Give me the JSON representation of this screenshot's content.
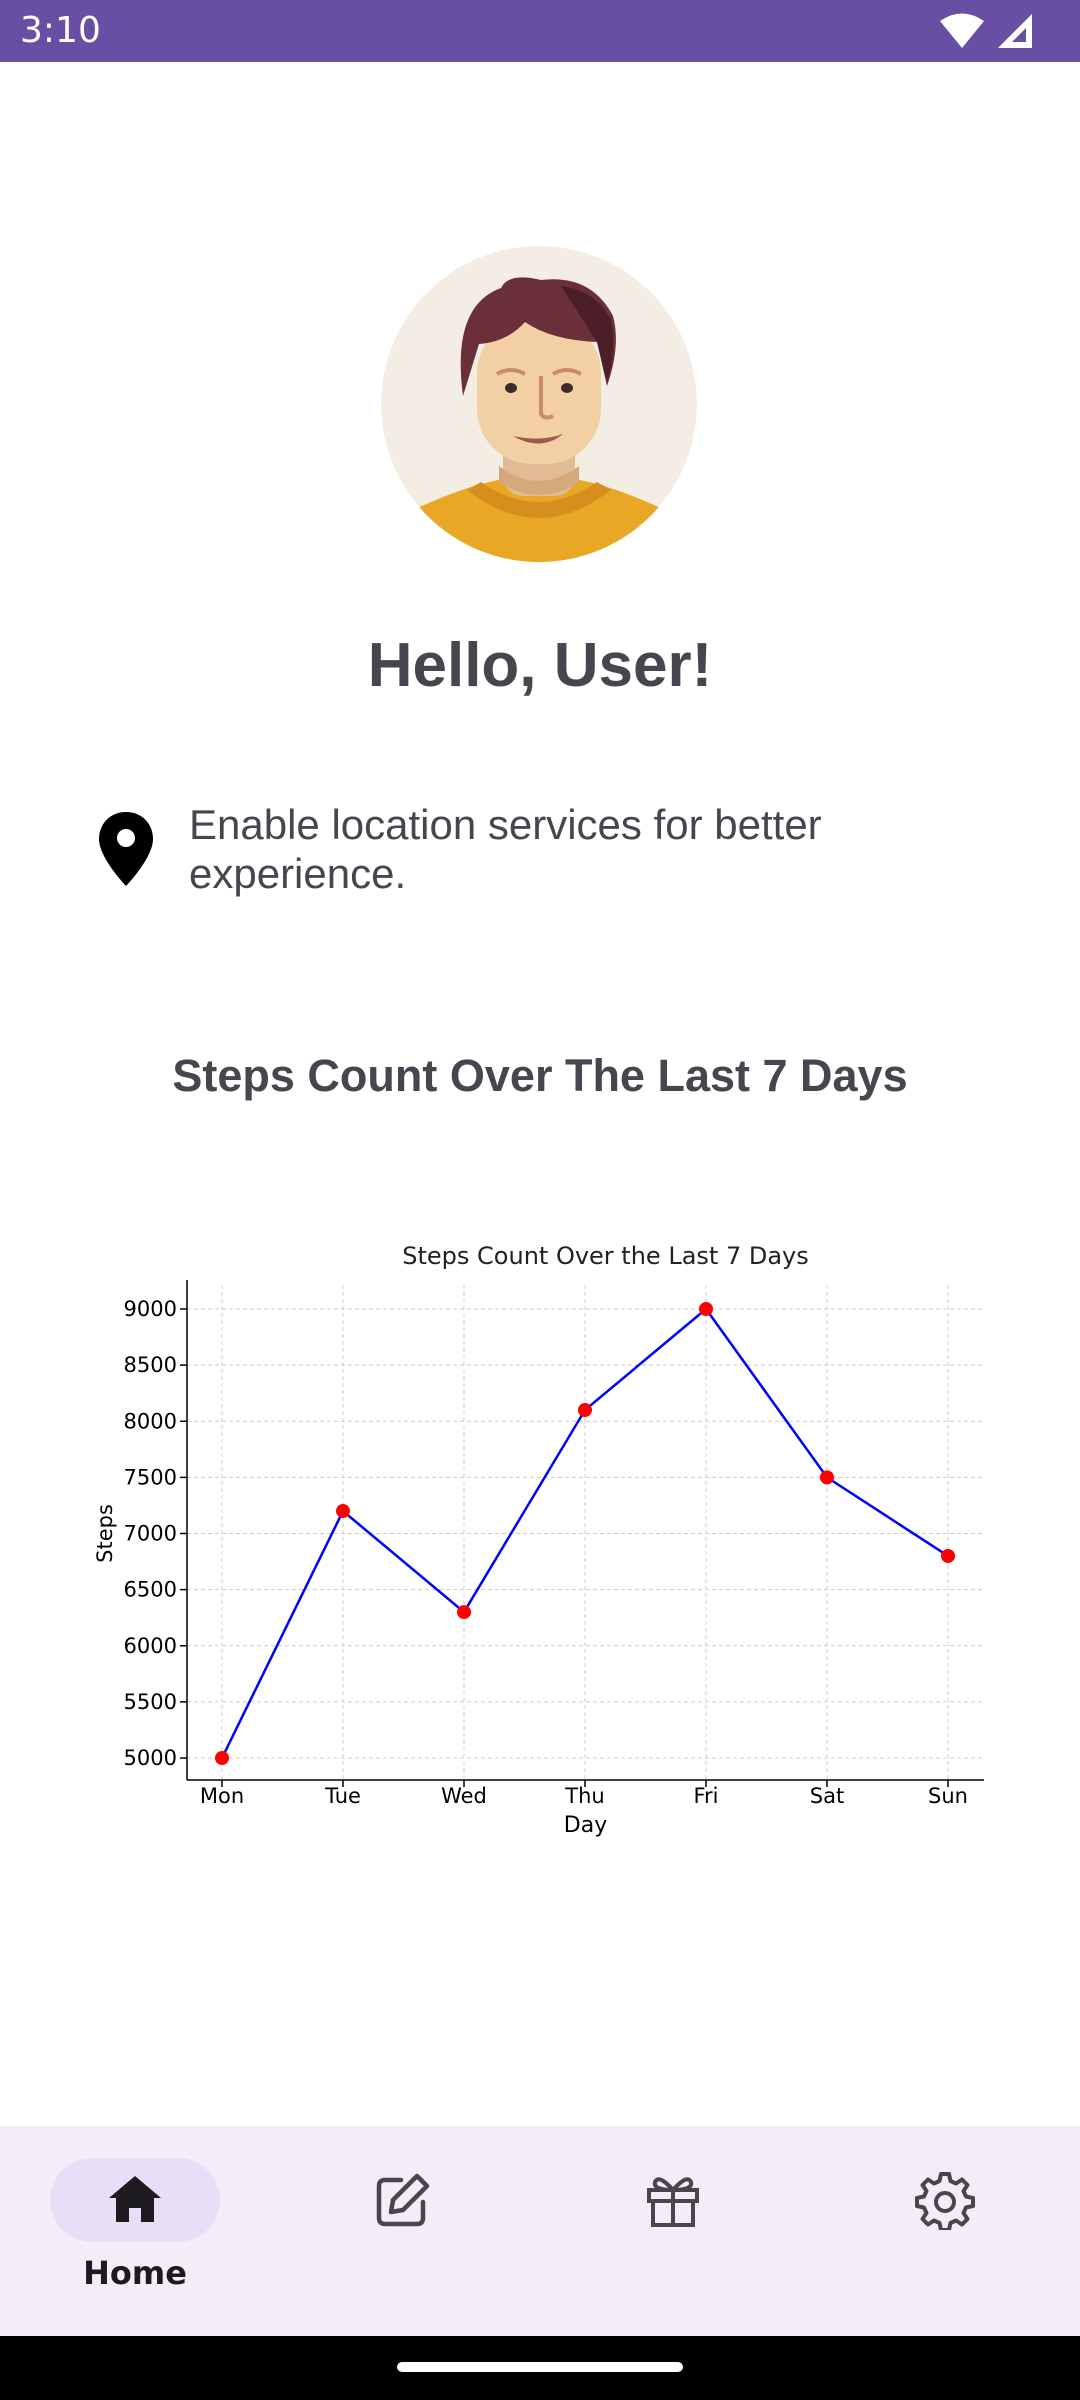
{
  "status_bar": {
    "time": "3:10",
    "icons": [
      "wifi-icon",
      "cell-signal-icon"
    ],
    "color": "#6750a4"
  },
  "profile": {
    "avatar_icon": "user-avatar-illustration",
    "greeting": "Hello, User!"
  },
  "location": {
    "icon": "location-pin-icon",
    "text_line1": "Enable location services for better",
    "text_line2": "experience."
  },
  "section": {
    "title": "Steps Count Over The Last 7 Days"
  },
  "chart_data": {
    "type": "line",
    "title": "Steps Count Over the Last 7 Days",
    "xlabel": "Day",
    "ylabel": "Steps",
    "categories": [
      "Mon",
      "Tue",
      "Wed",
      "Thu",
      "Fri",
      "Sat",
      "Sun"
    ],
    "values": [
      5000,
      7200,
      6300,
      8100,
      9000,
      7500,
      6800
    ],
    "ylim": [
      5000,
      9000
    ],
    "yticks": [
      5000,
      5500,
      6000,
      6500,
      7000,
      7500,
      8000,
      8500,
      9000
    ],
    "grid": true,
    "line_color": "#0000ff",
    "marker_color": "#ff0000"
  },
  "bottom_nav": {
    "items": [
      {
        "icon": "home-icon",
        "label": "Home",
        "active": true
      },
      {
        "icon": "edit-icon",
        "label": "",
        "active": false
      },
      {
        "icon": "gift-icon",
        "label": "",
        "active": false
      },
      {
        "icon": "settings-icon",
        "label": "",
        "active": false
      }
    ],
    "active_color": "#e8def8",
    "background": "#f3edf7"
  }
}
